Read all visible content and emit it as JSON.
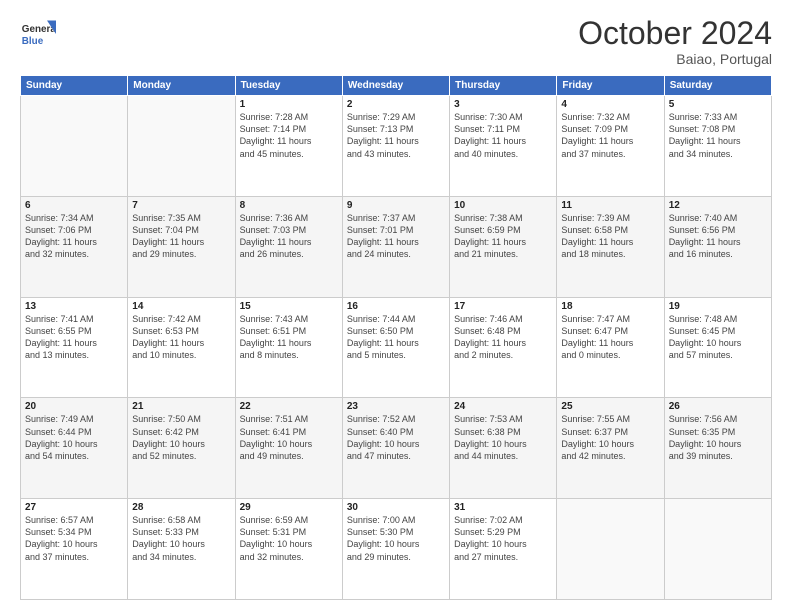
{
  "header": {
    "logo_general": "General",
    "logo_blue": "Blue",
    "title": "October 2024",
    "location": "Baiao, Portugal"
  },
  "days_of_week": [
    "Sunday",
    "Monday",
    "Tuesday",
    "Wednesday",
    "Thursday",
    "Friday",
    "Saturday"
  ],
  "weeks": [
    [
      {
        "day": "",
        "info": ""
      },
      {
        "day": "",
        "info": ""
      },
      {
        "day": "1",
        "info": "Sunrise: 7:28 AM\nSunset: 7:14 PM\nDaylight: 11 hours\nand 45 minutes."
      },
      {
        "day": "2",
        "info": "Sunrise: 7:29 AM\nSunset: 7:13 PM\nDaylight: 11 hours\nand 43 minutes."
      },
      {
        "day": "3",
        "info": "Sunrise: 7:30 AM\nSunset: 7:11 PM\nDaylight: 11 hours\nand 40 minutes."
      },
      {
        "day": "4",
        "info": "Sunrise: 7:32 AM\nSunset: 7:09 PM\nDaylight: 11 hours\nand 37 minutes."
      },
      {
        "day": "5",
        "info": "Sunrise: 7:33 AM\nSunset: 7:08 PM\nDaylight: 11 hours\nand 34 minutes."
      }
    ],
    [
      {
        "day": "6",
        "info": "Sunrise: 7:34 AM\nSunset: 7:06 PM\nDaylight: 11 hours\nand 32 minutes."
      },
      {
        "day": "7",
        "info": "Sunrise: 7:35 AM\nSunset: 7:04 PM\nDaylight: 11 hours\nand 29 minutes."
      },
      {
        "day": "8",
        "info": "Sunrise: 7:36 AM\nSunset: 7:03 PM\nDaylight: 11 hours\nand 26 minutes."
      },
      {
        "day": "9",
        "info": "Sunrise: 7:37 AM\nSunset: 7:01 PM\nDaylight: 11 hours\nand 24 minutes."
      },
      {
        "day": "10",
        "info": "Sunrise: 7:38 AM\nSunset: 6:59 PM\nDaylight: 11 hours\nand 21 minutes."
      },
      {
        "day": "11",
        "info": "Sunrise: 7:39 AM\nSunset: 6:58 PM\nDaylight: 11 hours\nand 18 minutes."
      },
      {
        "day": "12",
        "info": "Sunrise: 7:40 AM\nSunset: 6:56 PM\nDaylight: 11 hours\nand 16 minutes."
      }
    ],
    [
      {
        "day": "13",
        "info": "Sunrise: 7:41 AM\nSunset: 6:55 PM\nDaylight: 11 hours\nand 13 minutes."
      },
      {
        "day": "14",
        "info": "Sunrise: 7:42 AM\nSunset: 6:53 PM\nDaylight: 11 hours\nand 10 minutes."
      },
      {
        "day": "15",
        "info": "Sunrise: 7:43 AM\nSunset: 6:51 PM\nDaylight: 11 hours\nand 8 minutes."
      },
      {
        "day": "16",
        "info": "Sunrise: 7:44 AM\nSunset: 6:50 PM\nDaylight: 11 hours\nand 5 minutes."
      },
      {
        "day": "17",
        "info": "Sunrise: 7:46 AM\nSunset: 6:48 PM\nDaylight: 11 hours\nand 2 minutes."
      },
      {
        "day": "18",
        "info": "Sunrise: 7:47 AM\nSunset: 6:47 PM\nDaylight: 11 hours\nand 0 minutes."
      },
      {
        "day": "19",
        "info": "Sunrise: 7:48 AM\nSunset: 6:45 PM\nDaylight: 10 hours\nand 57 minutes."
      }
    ],
    [
      {
        "day": "20",
        "info": "Sunrise: 7:49 AM\nSunset: 6:44 PM\nDaylight: 10 hours\nand 54 minutes."
      },
      {
        "day": "21",
        "info": "Sunrise: 7:50 AM\nSunset: 6:42 PM\nDaylight: 10 hours\nand 52 minutes."
      },
      {
        "day": "22",
        "info": "Sunrise: 7:51 AM\nSunset: 6:41 PM\nDaylight: 10 hours\nand 49 minutes."
      },
      {
        "day": "23",
        "info": "Sunrise: 7:52 AM\nSunset: 6:40 PM\nDaylight: 10 hours\nand 47 minutes."
      },
      {
        "day": "24",
        "info": "Sunrise: 7:53 AM\nSunset: 6:38 PM\nDaylight: 10 hours\nand 44 minutes."
      },
      {
        "day": "25",
        "info": "Sunrise: 7:55 AM\nSunset: 6:37 PM\nDaylight: 10 hours\nand 42 minutes."
      },
      {
        "day": "26",
        "info": "Sunrise: 7:56 AM\nSunset: 6:35 PM\nDaylight: 10 hours\nand 39 minutes."
      }
    ],
    [
      {
        "day": "27",
        "info": "Sunrise: 6:57 AM\nSunset: 5:34 PM\nDaylight: 10 hours\nand 37 minutes."
      },
      {
        "day": "28",
        "info": "Sunrise: 6:58 AM\nSunset: 5:33 PM\nDaylight: 10 hours\nand 34 minutes."
      },
      {
        "day": "29",
        "info": "Sunrise: 6:59 AM\nSunset: 5:31 PM\nDaylight: 10 hours\nand 32 minutes."
      },
      {
        "day": "30",
        "info": "Sunrise: 7:00 AM\nSunset: 5:30 PM\nDaylight: 10 hours\nand 29 minutes."
      },
      {
        "day": "31",
        "info": "Sunrise: 7:02 AM\nSunset: 5:29 PM\nDaylight: 10 hours\nand 27 minutes."
      },
      {
        "day": "",
        "info": ""
      },
      {
        "day": "",
        "info": ""
      }
    ]
  ]
}
